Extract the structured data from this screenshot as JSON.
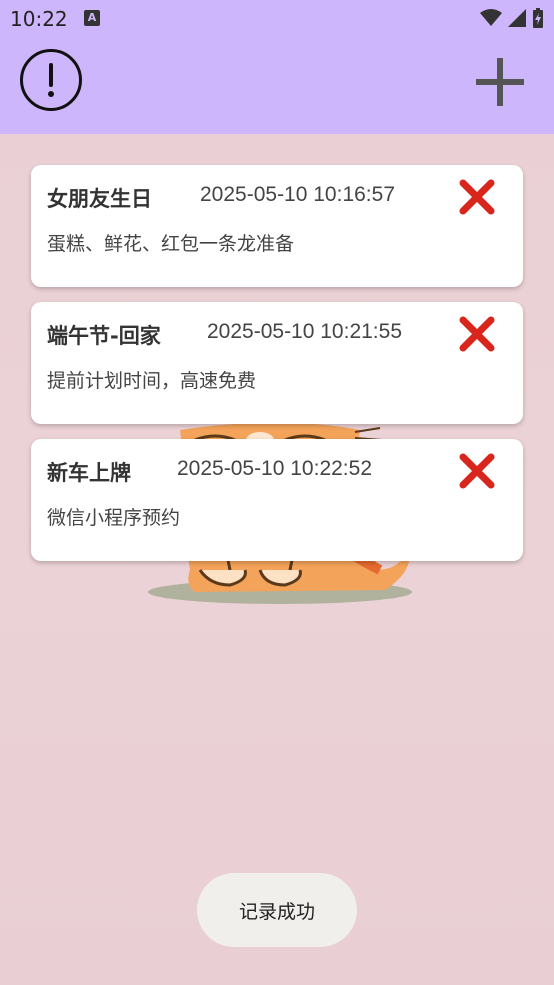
{
  "status": {
    "time": "10:22"
  },
  "toast": "记录成功",
  "records": [
    {
      "title": "女朋友生日",
      "datetime": "2025-05-10 10:16:57",
      "note": "蛋糕、鲜花、红包一条龙准备"
    },
    {
      "title": "端午节-回家",
      "datetime": "2025-05-10 10:21:55",
      "note": "提前计划时间，高速免费"
    },
    {
      "title": "新车上牌",
      "datetime": "2025-05-10 10:22:52",
      "note": "微信小程序预约"
    }
  ],
  "colors": {
    "appbar": "#cdb6fb",
    "delete": "#d9261c"
  },
  "icons": {
    "info": "alert-circle-icon",
    "add": "plus-icon",
    "delete": "close-x-icon"
  }
}
